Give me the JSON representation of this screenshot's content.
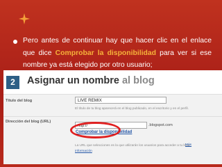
{
  "bullet": {
    "before": "Pero antes de continuar hay que hacer clic en el enlace que dice ",
    "highlight": "Comprobar la disponibilidad",
    "after": " para ver si ese nombre ya está elegido por otro usuario;"
  },
  "screenshot": {
    "step_number": "2",
    "step_title_main": "Asignar un nombre",
    "step_title_suffix": " al blog",
    "blog_title_label": "Título del blog",
    "blog_title_value": "LIVE REMIX",
    "blog_title_hint": "El título de tu blog aparecerá en el blog publicado, en el escritorio y en el perfil.",
    "address_label": "Dirección del blog (URL)",
    "address_prefix": "http://",
    "address_domain": ".blogspot.com",
    "check_link": "Comprobar la disponibilidad",
    "address_hint": "La URL que selecciones es la que utilizarán los usuarios para acceder a tu blog.",
    "more_link_1": "Más",
    "more_link_2": "información"
  },
  "colors": {
    "background": "#b3261e",
    "highlight": "#f6b23a",
    "accent_badge": "#2d5f86",
    "annotation_circle": "#e02020"
  }
}
